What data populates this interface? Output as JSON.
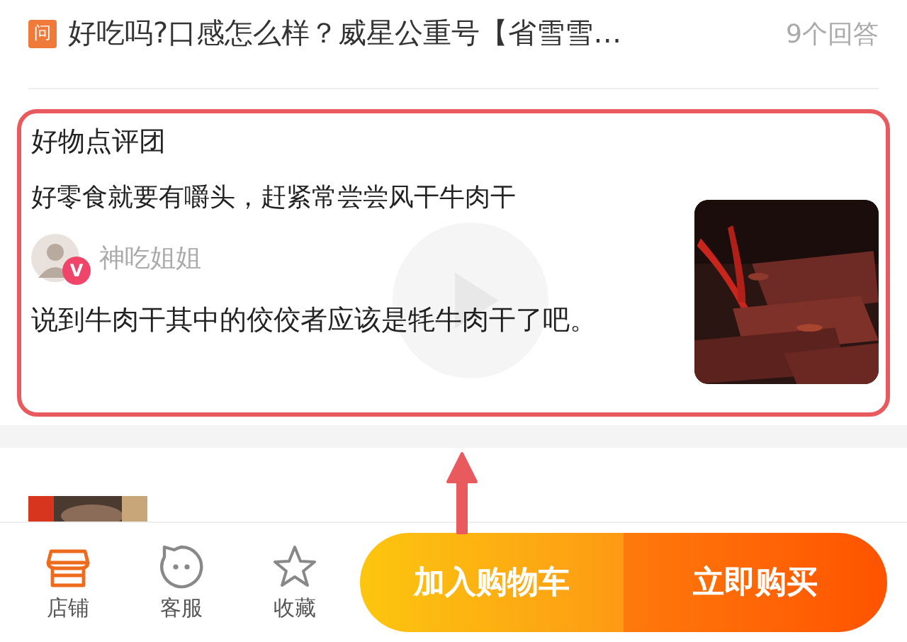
{
  "question": {
    "badge": "问",
    "text": "好吃吗?口感怎么样？威星公重号【省雪雪…",
    "answers": "9个回答"
  },
  "review": {
    "source": "好物点评团",
    "headline": "好零食就要有嚼头，赶紧常尝尝风干牛肉干",
    "author": {
      "name": "神吃姐姐",
      "badge": "V"
    },
    "body": "说到牛肉干其中的佼佼者应该是牦牛肉干了吧。",
    "highlighted": true
  },
  "tabbar": {
    "items": [
      {
        "label": "店铺",
        "kind": "shop"
      },
      {
        "label": "客服",
        "kind": "service"
      },
      {
        "label": "收藏",
        "kind": "favorite"
      }
    ],
    "buttons": [
      {
        "label": "加入购物车",
        "kind": "cart"
      },
      {
        "label": "立即购买",
        "kind": "buy"
      }
    ]
  }
}
